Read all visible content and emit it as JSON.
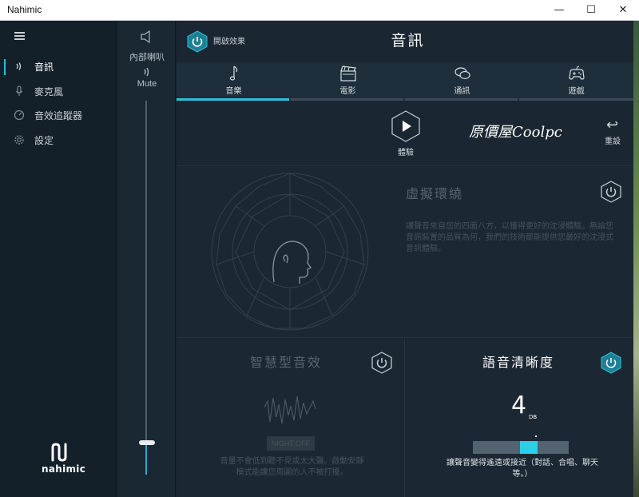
{
  "window": {
    "title": "Nahimic",
    "minimize": "—",
    "maximize": "☐",
    "close": "✕"
  },
  "sidebar": {
    "items": [
      {
        "label": "音訊",
        "icon": "audio-wave-icon",
        "active": true
      },
      {
        "label": "麥克風",
        "icon": "microphone-icon",
        "active": false
      },
      {
        "label": "音效追蹤器",
        "icon": "sound-tracker-icon",
        "active": false
      },
      {
        "label": "設定",
        "icon": "gear-icon",
        "active": false
      }
    ],
    "logo_text": "nahimic"
  },
  "volume": {
    "device_label": "內部喇叭",
    "mute_label": "Mute",
    "level_percent": 8
  },
  "header": {
    "enable_label": "開啟效果",
    "title": "音訊"
  },
  "tabs": [
    {
      "label": "音樂",
      "icon": "music-note-icon",
      "active": true
    },
    {
      "label": "電影",
      "icon": "clapperboard-icon",
      "active": false
    },
    {
      "label": "通訊",
      "icon": "chat-bubbles-icon",
      "active": false
    },
    {
      "label": "遊戲",
      "icon": "gamepad-icon",
      "active": false
    }
  ],
  "actions": {
    "play_label": "體驗",
    "brand": "原價屋Coolpc",
    "reset_label": "重設"
  },
  "virtual_surround": {
    "title": "虛擬環繞",
    "desc": "讓聲音來自您的四面八方，以獲得更好的沈浸體驗。無論您音訊裝置的品質為何，我們的技術都能提供您最好的沈浸式音訊體驗。"
  },
  "smart_volume": {
    "title": "智慧型音效",
    "night_label": "NIGHT OFF",
    "desc": "音量不會低到聽不見或太大聲。啟動安靜模式能讓您周圍的人不被打擾。"
  },
  "voice_clarity": {
    "title": "語音清晰度",
    "value": "4",
    "unit": "DB",
    "desc": "讓聲音變得遙遠或接近（對話、合唱、聊天等。）"
  },
  "colors": {
    "accent": "#2bc1d7",
    "power_active": "#1e7f95"
  }
}
